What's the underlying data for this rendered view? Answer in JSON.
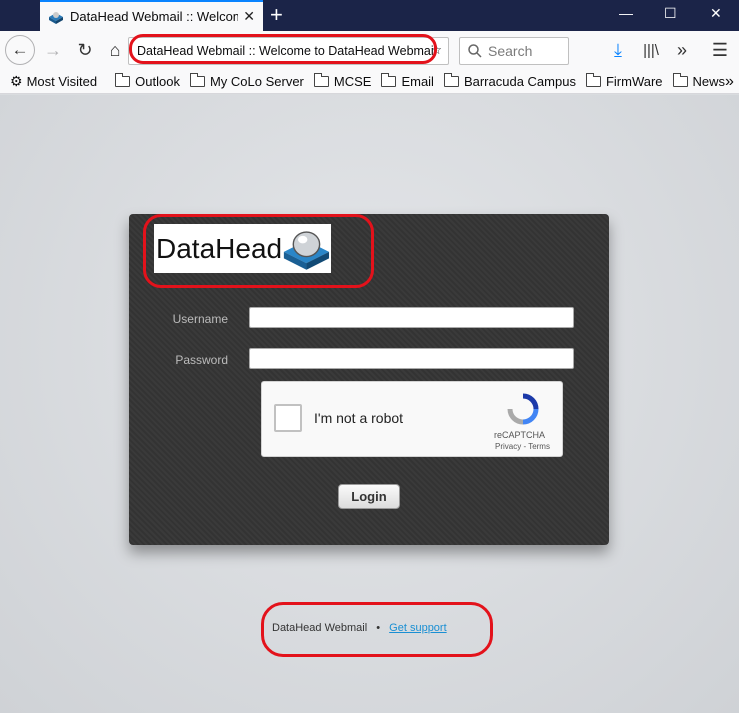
{
  "browser": {
    "tab_title": "DataHead Webmail :: Welcome to DataHead Webmail",
    "url": "DataHead Webmail :: Welcome to DataHead Webmail",
    "search_placeholder": "Search",
    "window_controls": {
      "minimize": "—",
      "maximize": "☐",
      "close": "✕"
    }
  },
  "bookmarks": [
    "Most Visited",
    "Outlook",
    "My CoLo Server",
    "MCSE",
    "Email",
    "Barracuda Campus",
    "FirmWare",
    "News"
  ],
  "login": {
    "logo_text": "DataHead",
    "username_label": "Username",
    "password_label": "Password",
    "username_value": "",
    "password_value": "",
    "captcha_label": "I'm not a robot",
    "captcha_brand": "reCAPTCHA",
    "captcha_links": "Privacy - Terms",
    "submit_label": "Login"
  },
  "footer": {
    "product_name": "DataHead Webmail",
    "separator": "•",
    "support_link": "Get support"
  },
  "colors": {
    "tabstrip": "#1b2448",
    "accent": "#0a84ff",
    "highlight": "#e3121b",
    "link": "#1a8fd3"
  }
}
